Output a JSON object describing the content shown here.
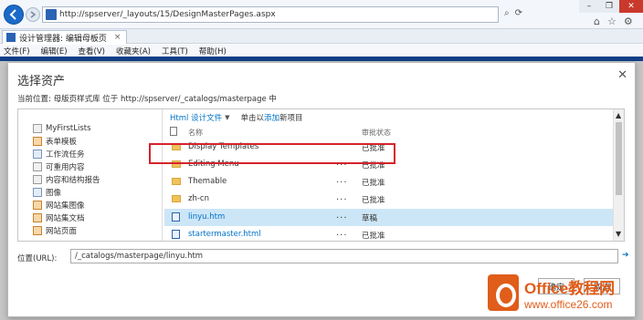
{
  "browser": {
    "address": "http://spserver/_layouts/15/DesignMasterPages.aspx",
    "tab_title": "设计管理器: 编辑母板页",
    "menu": [
      "文件(F)",
      "编辑(E)",
      "查看(V)",
      "收藏夹(A)",
      "工具(T)",
      "帮助(H)"
    ]
  },
  "dialog": {
    "title": "选择资产",
    "location": "当前位置: 母版页样式库 位于 http://spserver/_catalogs/masterpage 中",
    "tree": [
      "MyFirstLists",
      "表单模板",
      "工作流任务",
      "可重用内容",
      "内容和结构报告",
      "图像",
      "网站集图像",
      "网站集文档",
      "网站页面"
    ],
    "toolbar": {
      "view": "Html 设计文件",
      "click_prefix": "单击以",
      "add_link": "添加",
      "add_suffix": "新项目"
    },
    "columns": {
      "name": "名称",
      "status": "审批状态"
    },
    "rows": [
      {
        "name": "Display Templates",
        "status": "已批准",
        "type": "folder"
      },
      {
        "name": "Editing Menu",
        "status": "已批准",
        "type": "folder"
      },
      {
        "name": "Themable",
        "status": "已批准",
        "type": "folder"
      },
      {
        "name": "zh-cn",
        "status": "已批准",
        "type": "folder"
      },
      {
        "name": "linyu.htm",
        "status": "草稿",
        "type": "file"
      },
      {
        "name": "startermaster.html",
        "status": "已批准",
        "type": "file"
      }
    ],
    "url_label": "位置(URL):",
    "url_value": "/_catalogs/masterpage/linyu.htm",
    "buttons": {
      "ok": "确定",
      "cancel": "取消"
    }
  },
  "watermark": {
    "brand": "Office教程网",
    "url": "www.office26.com"
  },
  "colors": {
    "accent": "#0072c6",
    "selection": "#cde6f7",
    "highlight_border": "#d6232a",
    "watermark": "#e05d1a"
  }
}
